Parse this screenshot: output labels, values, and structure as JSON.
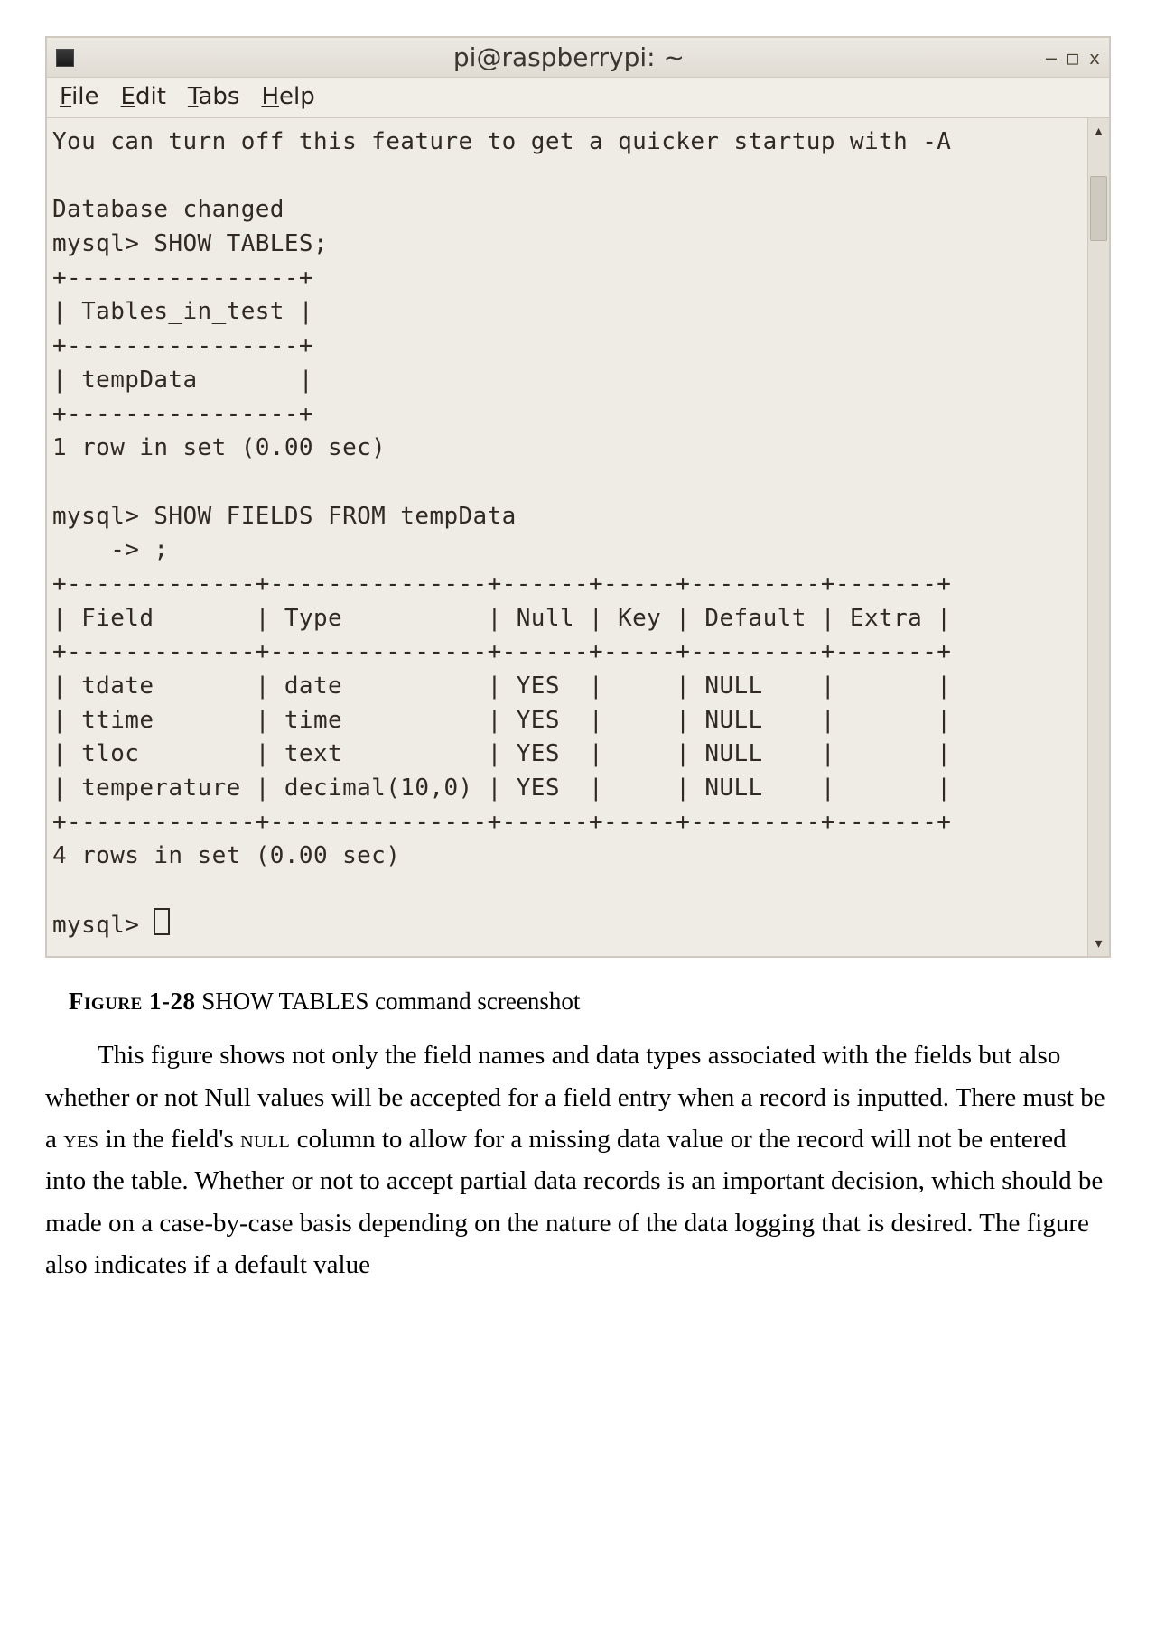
{
  "window": {
    "title": "pi@raspberrypi: ~",
    "menus": {
      "file": "File",
      "edit": "Edit",
      "tabs": "Tabs",
      "help": "Help"
    },
    "controls": {
      "minimize": "–",
      "maximize": "□",
      "close": "x"
    }
  },
  "terminal": {
    "lines": {
      "hint": "You can turn off this feature to get a quicker startup with -A",
      "blank": "",
      "db_changed": "Database changed",
      "prompt_showtables": "mysql> SHOW TABLES;",
      "tbl_border": "+----------------+",
      "tbl_header": "| Tables_in_test |",
      "tbl_row1": "| tempData       |",
      "rows1": "1 row in set (0.00 sec)",
      "prompt_showfields1": "mysql> SHOW FIELDS FROM tempData",
      "prompt_showfields2": "    -> ;",
      "fields_border": "+-------------+---------------+------+-----+---------+-------+",
      "fields_header": "| Field       | Type          | Null | Key | Default | Extra |",
      "fields_row1": "| tdate       | date          | YES  |     | NULL    |       |",
      "fields_row2": "| ttime       | time          | YES  |     | NULL    |       |",
      "fields_row3": "| tloc        | text          | YES  |     | NULL    |       |",
      "fields_row4": "| temperature | decimal(10,0) | YES  |     | NULL    |       |",
      "rows2": "4 rows in set (0.00 sec)",
      "final_prompt": "mysql> "
    }
  },
  "caption": {
    "id_label": "Figure 1-28",
    "text": " SHOW TABLES command screenshot"
  },
  "paragraph": {
    "p1a": "This figure shows not only the field names and data types associated with the fields but also whether or not Null values will be accepted for a field entry when a record is inputted. There must be a ",
    "yes_word": "yes",
    "p1b": " in the field's ",
    "null_word": "null",
    "p1c": " column to allow for a missing data value or the record will not be entered into the table. Whether or not to accept partial data records is an important decision, which should be made on a case-by-case basis depending on the nature of the data logging that is desired. The figure also indicates if a default value"
  },
  "chart_data": {
    "type": "table",
    "title": "SHOW FIELDS FROM tempData",
    "columns": [
      "Field",
      "Type",
      "Null",
      "Key",
      "Default",
      "Extra"
    ],
    "rows": [
      [
        "tdate",
        "date",
        "YES",
        "",
        "NULL",
        ""
      ],
      [
        "ttime",
        "time",
        "YES",
        "",
        "NULL",
        ""
      ],
      [
        "tloc",
        "text",
        "YES",
        "",
        "NULL",
        ""
      ],
      [
        "temperature",
        "decimal(10,0)",
        "YES",
        "",
        "NULL",
        ""
      ]
    ],
    "show_tables": {
      "columns": [
        "Tables_in_test"
      ],
      "rows": [
        [
          "tempData"
        ]
      ]
    }
  }
}
